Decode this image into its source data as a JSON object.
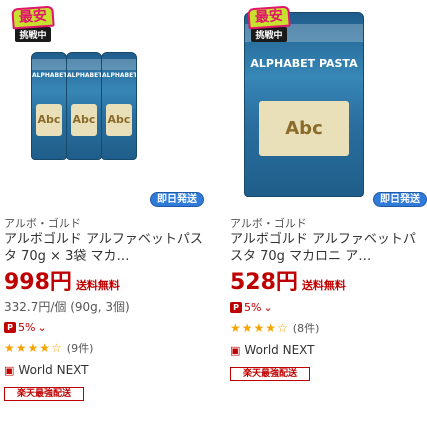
{
  "products": [
    {
      "promo": {
        "badge_top": "最安",
        "badge_bottom": "挑戦中"
      },
      "bag_brand": "ALPHABET",
      "bag_label": "Abc",
      "ship_badge": "即日発送",
      "brand": "アルボ・ゴルド",
      "title": "アルボゴルド アルファベットパスタ 70g × 3袋 マカ…",
      "price": "998円",
      "shipping": "送料無料",
      "unit_price": "332.7円/個 (90g, 3個)",
      "points": "5%",
      "rating_stars": "★★★★☆",
      "rating_count": "(9件)",
      "shop_name": "World NEXT",
      "rakuten_badge": "楽天最強配送"
    },
    {
      "promo": {
        "badge_top": "最安",
        "badge_bottom": "挑戦中"
      },
      "bag_brand": "ALPHABET PASTA",
      "bag_label": "Abc",
      "ship_badge": "即日発送",
      "brand": "アルボ・ゴルド",
      "title": "アルボゴルド アルファベットパスタ 70g マカロニ ア…",
      "price": "528円",
      "shipping": "送料無料",
      "points": "5%",
      "rating_stars": "★★★★☆",
      "rating_count": "(8件)",
      "shop_name": "World NEXT",
      "rakuten_badge": "楽天最強配送"
    }
  ]
}
